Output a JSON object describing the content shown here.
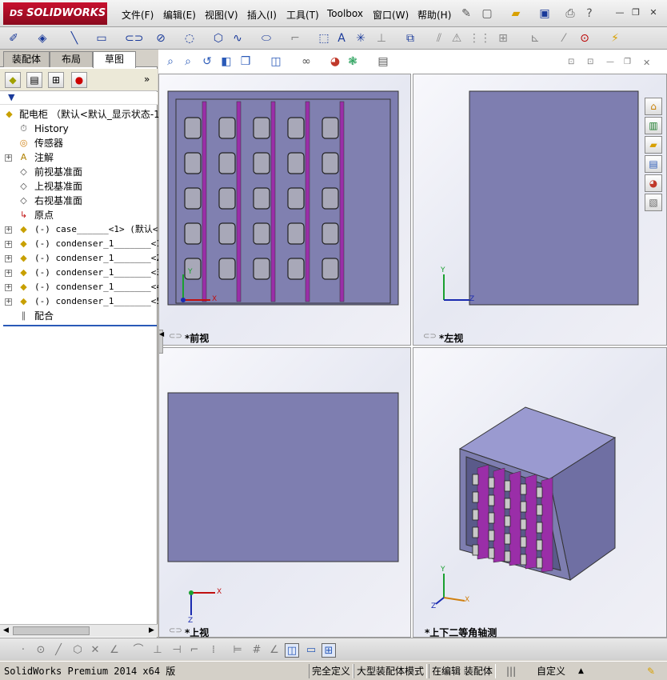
{
  "app": {
    "logo_ds": "DS",
    "logo_text": "SOLIDWORKS"
  },
  "menu": [
    "文件(F)",
    "编辑(E)",
    "视图(V)",
    "插入(I)",
    "工具(T)",
    "Toolbox",
    "窗口(W)",
    "帮助(H)"
  ],
  "tabs": [
    "装配体",
    "布局",
    "草图"
  ],
  "tree": {
    "root": "配电柜 （默认<默认_显示状态-1",
    "items": [
      {
        "label": "History",
        "icon": "history-icon",
        "exp": false
      },
      {
        "label": "传感器",
        "icon": "sensor-icon",
        "exp": false
      },
      {
        "label": "注解",
        "icon": "annotation-icon",
        "exp": true
      },
      {
        "label": "前视基准面",
        "icon": "plane-icon",
        "exp": false
      },
      {
        "label": "上视基准面",
        "icon": "plane-icon",
        "exp": false
      },
      {
        "label": "右视基准面",
        "icon": "plane-icon",
        "exp": false
      },
      {
        "label": "原点",
        "icon": "origin-icon",
        "exp": false
      },
      {
        "label": "(-) case______<1> (默认<",
        "icon": "part-icon",
        "exp": true
      },
      {
        "label": "(-) condenser_1_______<1>",
        "icon": "part-icon",
        "exp": true
      },
      {
        "label": "(-) condenser_1_______<2>",
        "icon": "part-icon",
        "exp": true
      },
      {
        "label": "(-) condenser_1_______<3>",
        "icon": "part-icon",
        "exp": true
      },
      {
        "label": "(-) condenser_1_______<4>",
        "icon": "part-icon",
        "exp": true
      },
      {
        "label": "(-) condenser_1_______<5>",
        "icon": "part-icon",
        "exp": true
      },
      {
        "label": "配合",
        "icon": "mates-icon",
        "exp": false
      }
    ]
  },
  "viewports": {
    "front": "*前视",
    "left": "*左视",
    "top": "*上视",
    "iso": "*上下二等角轴测"
  },
  "axes": {
    "x": "X",
    "y": "Y",
    "z": "Z"
  },
  "status": {
    "product": "SolidWorks Premium 2014 x64 版",
    "defined": "完全定义",
    "mode": "大型装配体模式",
    "editing": "在编辑 装配体",
    "custom": "自定义"
  },
  "colors": {
    "body": "#7e7eb0",
    "panel": "#6f6fa3",
    "rail": "#9a2ea8",
    "logo": "#c8102e"
  }
}
